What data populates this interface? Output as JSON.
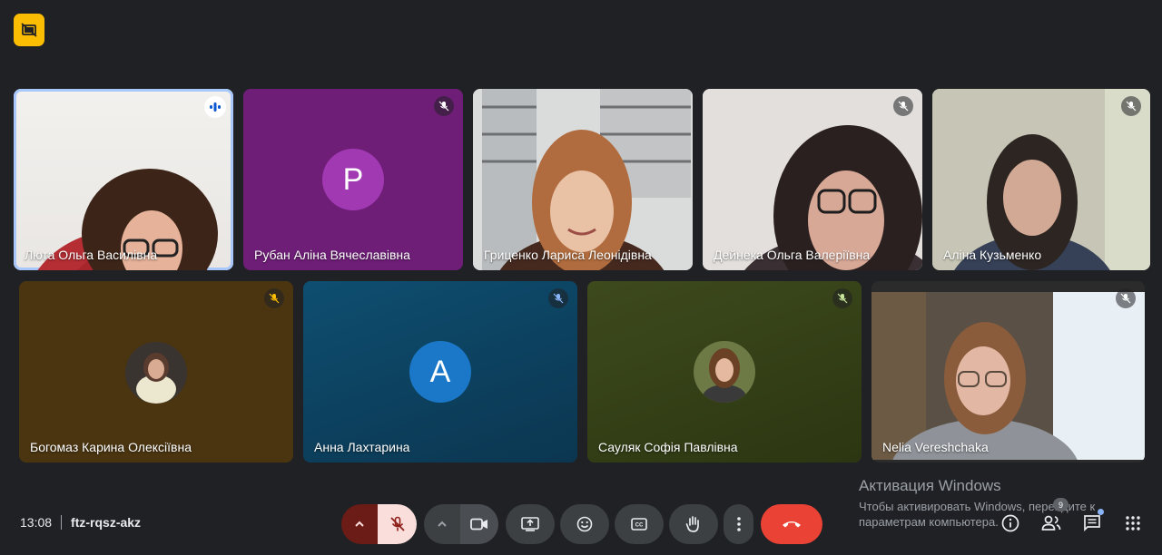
{
  "meeting": {
    "time": "13:08",
    "code": "ftz-rqsz-akz"
  },
  "participants": [
    {
      "name": "Люта Ольга Василівна"
    },
    {
      "name": "Рубан Аліна Вячеславівна",
      "initial": "P"
    },
    {
      "name": "Гриценко Лариса Леонідівна"
    },
    {
      "name": "Дейнека Ольга Валеріївна"
    },
    {
      "name": "Аліна Кузьменко"
    },
    {
      "name": "Богомаз Карина Олексіївна"
    },
    {
      "name": "Анна Лахтарина",
      "initial": "A"
    },
    {
      "name": "Сауляк Софія Павлівна"
    },
    {
      "name": "Nelia Vereshchaka"
    }
  ],
  "watermark": {
    "title": "Активация Windows",
    "line1": "Чтобы активировать Windows, перейдите к",
    "line2": "параметрам компьютера."
  },
  "people_count": "9",
  "colors": {
    "background": "#202124",
    "leave": "#ea4335",
    "mic_off": "#f9dedc",
    "active_outline": "#a8c7fa",
    "badge": "#fbbc04"
  }
}
